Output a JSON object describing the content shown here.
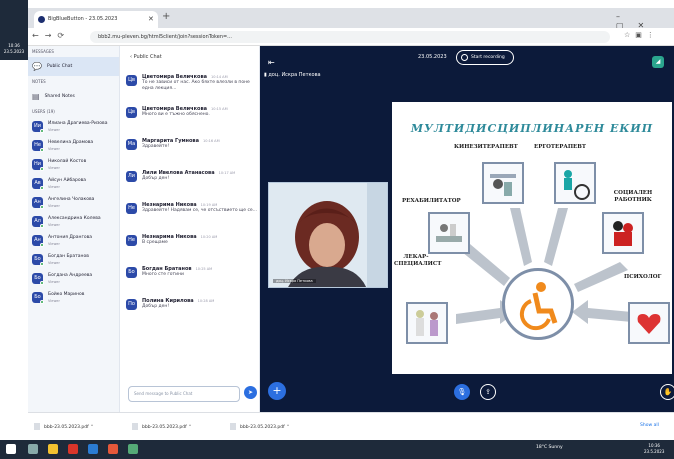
{
  "desktop": {
    "corner_text": "10:36\n23.5.2023"
  },
  "browser": {
    "tab_title": "BigBlueButton - 23.05.2023",
    "url": "bbb2.mu-pleven.bg/html5client/join?sessionToken=...",
    "downloads": [
      "bbb-23.05.2023.pdf",
      "bbb-23.05.2023.pdf",
      "bbb-23.05.2023.pdf"
    ],
    "show_all": "Show all"
  },
  "sidebar": {
    "messages_header": "MESSAGES",
    "public_chat": "Public Chat",
    "notes_header": "NOTES",
    "shared_notes": "Shared Notes",
    "users_header": "USERS (19)",
    "users": [
      {
        "initials": "Ии",
        "name": "Илиана Драгиева-Ризова",
        "sub": "Viewer"
      },
      {
        "initials": "Не",
        "name": "Невелина Драмова",
        "sub": "Viewer"
      },
      {
        "initials": "Ни",
        "name": "Николай Костов",
        "sub": "Viewer"
      },
      {
        "initials": "Ав",
        "name": "Айсун Айбарова",
        "sub": "Viewer"
      },
      {
        "initials": "Ан",
        "name": "Ангелина Чолакова",
        "sub": "Viewer"
      },
      {
        "initials": "Ал",
        "name": "Александрина Колева",
        "sub": "Viewer"
      },
      {
        "initials": "Ан",
        "name": "Антония Дрангова",
        "sub": "Viewer"
      },
      {
        "initials": "Бо",
        "name": "Богдан Братанов",
        "sub": "Viewer"
      },
      {
        "initials": "Бо",
        "name": "Богдана Андреева",
        "sub": "Viewer"
      },
      {
        "initials": "Бо",
        "name": "Бойко Маринов",
        "sub": "Viewer"
      }
    ]
  },
  "chat": {
    "header": "Public Chat",
    "input_placeholder": "Send message to Public Chat",
    "messages": [
      {
        "initials": "Цв",
        "name": "Цветомира Величкова",
        "time": "10:14 AM",
        "text": "То не зависи от нас. Ако бяхте влезли в поне една лекция..."
      },
      {
        "initials": "Цв",
        "name": "Цветомира Величкова",
        "time": "10:15 AM",
        "text": "Много ви е тъжно обяснено."
      },
      {
        "initials": "Ма",
        "name": "Маргарита Гумнова",
        "time": "10:16 AM",
        "text": "Здравейте!"
      },
      {
        "initials": "Ли",
        "name": "Лили Ивелова Атанасова",
        "time": "10:17 AM",
        "text": "Добър ден!"
      },
      {
        "initials": "Не",
        "name": "Незнарима Никова",
        "time": "10:19 AM",
        "text": "Здравейте! Надявам се, че отсъствието ще се..."
      },
      {
        "initials": "Не",
        "name": "Незнарима Никова",
        "time": "10:20 AM",
        "text": "В срещаме"
      },
      {
        "initials": "Бо",
        "name": "Богдан Братанов",
        "time": "10:25 AM",
        "text": "Много сте готини"
      },
      {
        "initials": "По",
        "name": "Полина Кирилова",
        "time": "10:28 AM",
        "text": "Добър ден!"
      }
    ]
  },
  "presentation": {
    "date": "23.05.2023",
    "record_label": "Start recording",
    "presenter_label": "доц. Искра Петкова",
    "webcam_label": "доц. Искра Петкова",
    "slide_title": "МУЛТИДИСЦИПЛИНАРЕН ЕКИП",
    "roles": [
      "КИНЕЗИТЕРАПЕВТ",
      "ЕРГОТЕРАПЕВТ",
      "РЕХАБИЛИТАТОР",
      "СОЦИАЛЕН РАБОТНИК",
      "ЛЕКАР-СПЕЦИАЛИСТ",
      "ПСИХОЛОГ"
    ]
  },
  "taskbar": {
    "tray": "18°C Sunny",
    "time": "10:36",
    "date": "23.5.2023"
  }
}
